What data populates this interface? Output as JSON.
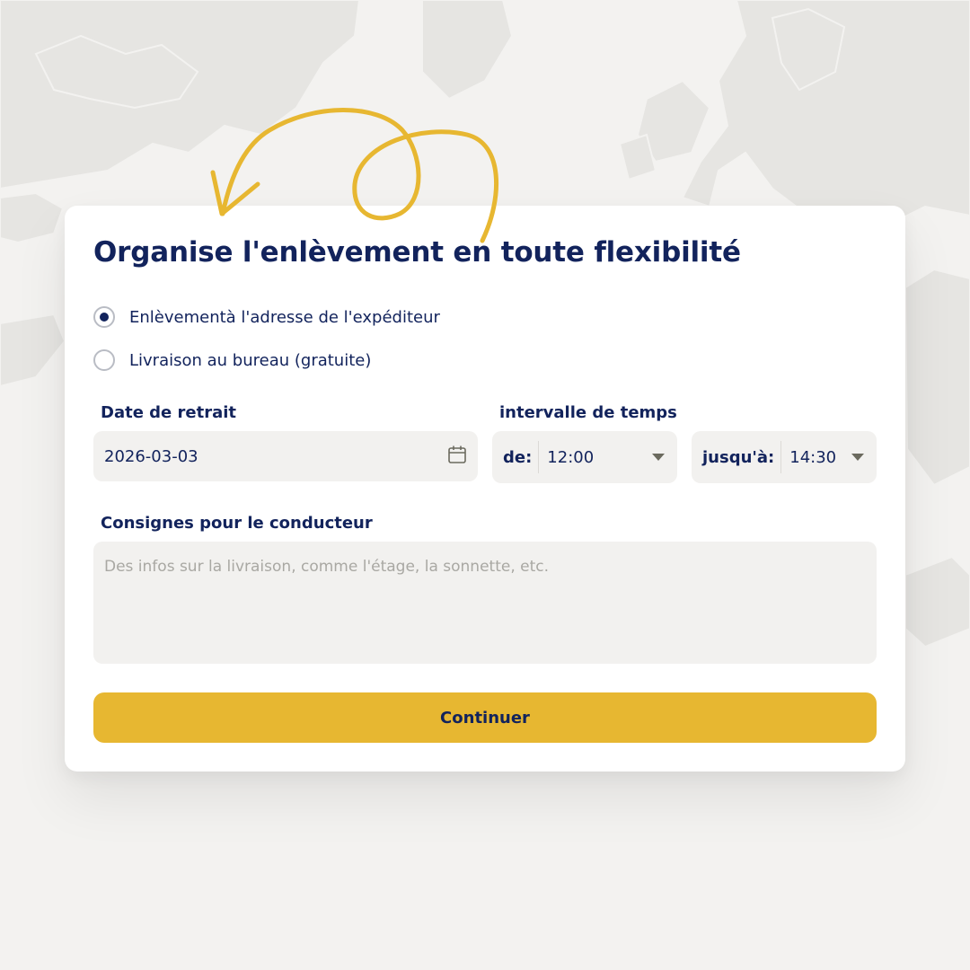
{
  "form": {
    "title": "Organise l'enlèvement en toute flexibilité",
    "options": [
      {
        "label": "Enlèvementà l'adresse de l'expéditeur",
        "selected": true
      },
      {
        "label": "Livraison au bureau (gratuite)",
        "selected": false
      }
    ],
    "date": {
      "label": "Date de retrait",
      "value": "2026-03-03",
      "icon": "calendar-icon"
    },
    "time": {
      "label": "intervalle de temps",
      "from_label": "de:",
      "from_value": "12:00",
      "to_label": "jusqu'à:",
      "to_value": "14:30"
    },
    "notes": {
      "label": "Consignes pour le conducteur",
      "placeholder": "Des infos sur la livraison, comme l'étage, la sonnette, etc."
    },
    "continue_label": "Continuer"
  },
  "colors": {
    "primary": "#12235c",
    "accent": "#e7b731",
    "field_bg": "#f2f1ef",
    "page_bg": "#f3f2f0"
  }
}
